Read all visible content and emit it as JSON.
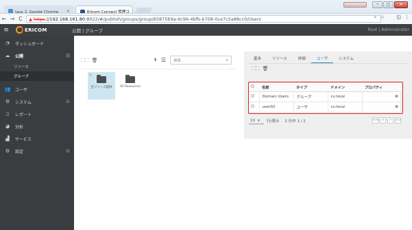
{
  "browser": {
    "tabs": [
      {
        "title": "Java と Google Chrome",
        "close": "×"
      },
      {
        "title": "Ericom Connect 管理コ",
        "close": "×"
      }
    ],
    "url_warning": "▲",
    "url_scheme": "https",
    "url_host": "://192.168.161.80",
    "url_path": ":8022/#/publish/groups/group/65875b9a-9c96-4bfb-b708-0ce7c5a88cc0/Users",
    "window_controls": [
      "─",
      "▢",
      "✕"
    ]
  },
  "header": {
    "brand": "ERICOM",
    "breadcrumb": "公開 | グループ",
    "user": "Root | Administrator"
  },
  "sidebar": {
    "items": [
      {
        "label": "ダッシュボード",
        "icon": "dashboard-icon"
      },
      {
        "label": "公開",
        "icon": "cloud-icon",
        "plus": "⊞"
      },
      {
        "label": "システム",
        "icon": "gear-icon",
        "plus": "⊞"
      },
      {
        "label": "レポート",
        "icon": "document-icon"
      },
      {
        "label": "分析",
        "icon": "pie-icon"
      },
      {
        "label": "サービス",
        "icon": "bars-icon"
      },
      {
        "label": "設定",
        "icon": "settings-icon",
        "plus": "⊞"
      }
    ],
    "sub_items": [
      "リソース",
      "グループ"
    ],
    "users_label": "ユーザ"
  },
  "left_panel": {
    "search_placeholder": "検索...",
    "tiles": [
      {
        "label": "全リソース削除"
      },
      {
        "label": "All Resources"
      }
    ]
  },
  "right_panel": {
    "tabs": [
      "基本",
      "リソース",
      "詳細",
      "ユーザ",
      "システム"
    ],
    "active_tab": "ユーザ",
    "table": {
      "headers": [
        "名前",
        "タイプ",
        "ドメイン",
        "プロパティ"
      ],
      "rows": [
        {
          "name": "Domain Users",
          "type": "グループ",
          "domain": "cv.local"
        },
        {
          "name": "user02",
          "type": "ユーザ",
          "domain": "cv.local"
        }
      ]
    },
    "pager": {
      "per_page": "10",
      "per_page_label": "行/表示",
      "info": "2 行中 1 / 2",
      "buttons": [
        "<<",
        "<",
        ">",
        ">>"
      ]
    }
  },
  "colors": {
    "header_bg": "#3c4042",
    "sidebar_bg": "#3a3d3f",
    "accent": "#2a7ab5",
    "highlight": "#e02020"
  }
}
